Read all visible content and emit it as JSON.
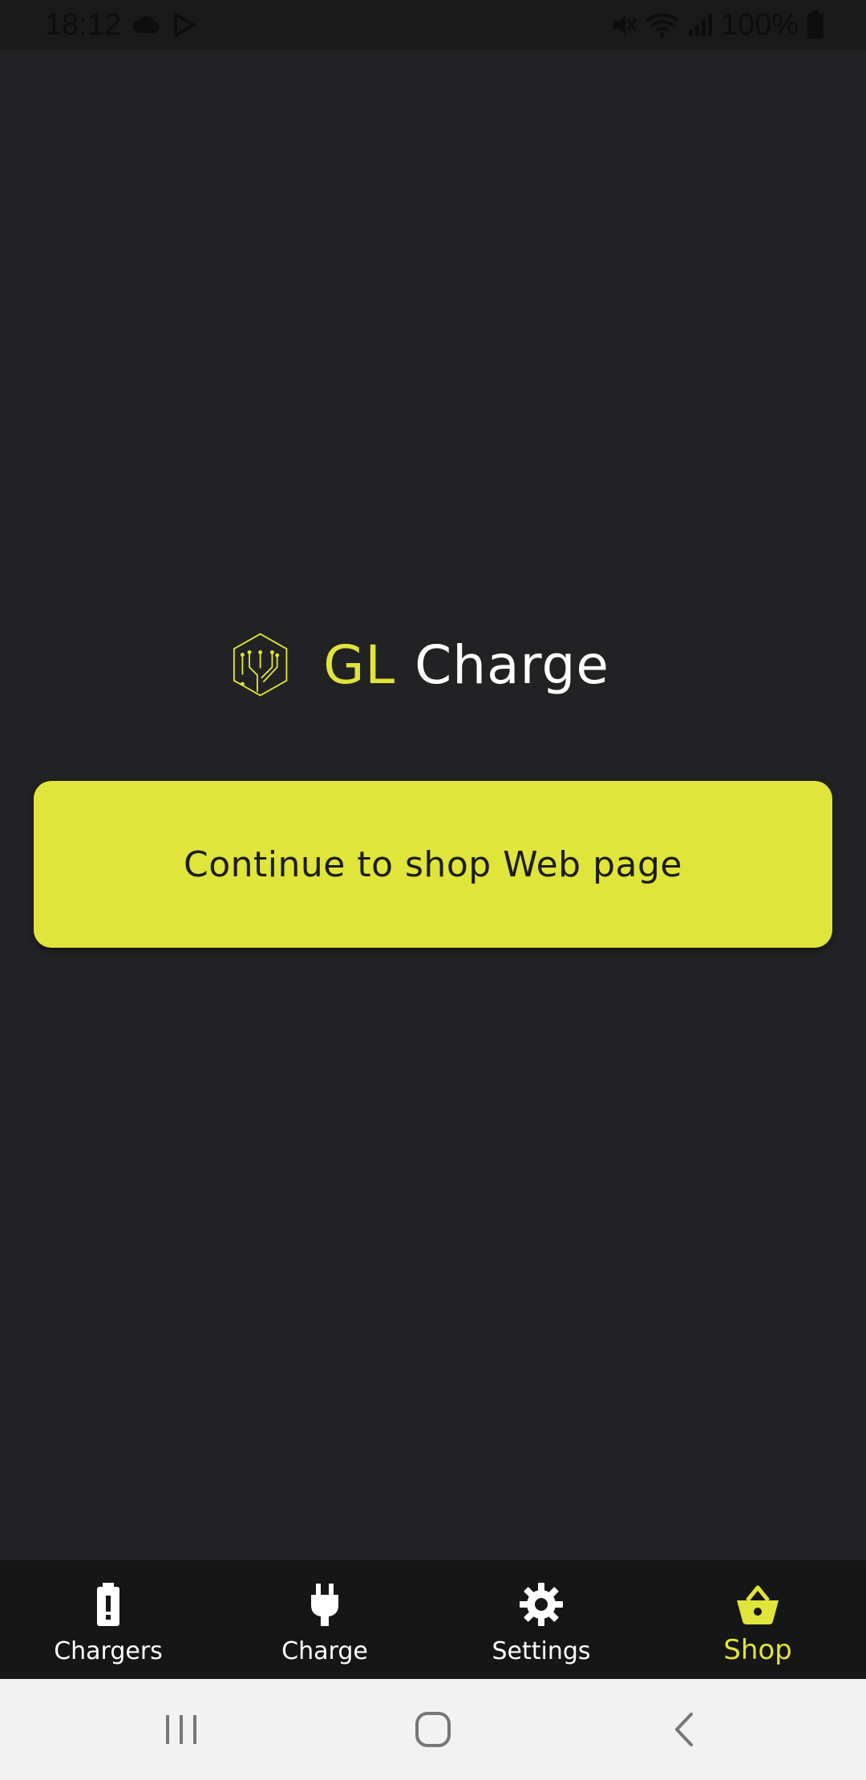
{
  "status_bar": {
    "time": "18:12",
    "battery": "100%"
  },
  "logo": {
    "gl_text": "GL",
    "charge_text": "Charge"
  },
  "main": {
    "cta_label": "Continue to shop Web page"
  },
  "bottom_nav": {
    "items": [
      {
        "label": "Chargers",
        "icon": "battery-alert-icon",
        "active": false
      },
      {
        "label": "Charge",
        "icon": "plug-icon",
        "active": false
      },
      {
        "label": "Settings",
        "icon": "gear-icon",
        "active": false
      },
      {
        "label": "Shop",
        "icon": "basket-icon",
        "active": true
      }
    ]
  },
  "colors": {
    "accent": "#e1e43a",
    "background": "#222224",
    "nav_background": "#161617"
  }
}
